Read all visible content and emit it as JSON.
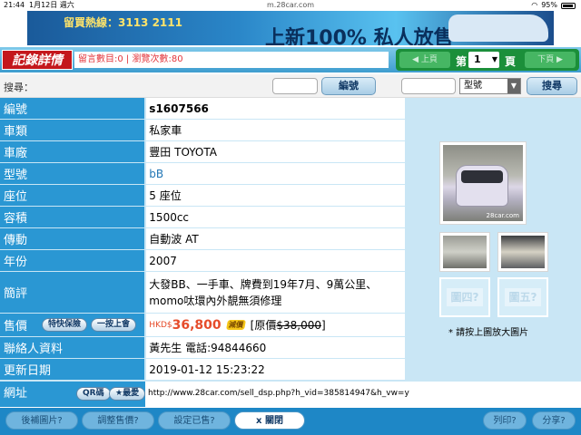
{
  "status": {
    "time": "21:44",
    "date": "1月12日 週六",
    "url": "m.28car.com",
    "battery": "95%"
  },
  "banner": {
    "left_text": "留買熱線：3113 2111",
    "big_text": "上新100% 私人放售"
  },
  "header": {
    "logo": "記錄詳情",
    "stats": "留言數目:0 | 瀏覽次數:80",
    "prev": "上頁",
    "next": "下頁",
    "di": "第",
    "page": "1",
    "ye": "頁"
  },
  "search": {
    "label": "搜尋：",
    "btn_number": "編號",
    "select_value": "型號",
    "btn_search": "搜尋"
  },
  "details": {
    "number_label": "編號",
    "number_value": "s1607566",
    "category_label": "車類",
    "category_value": "私家車",
    "make_label": "車廠",
    "make_value": "豐田 TOYOTA",
    "model_label": "型號",
    "model_value": "bB",
    "seats_label": "座位",
    "seats_value": "5 座位",
    "engine_label": "容積",
    "engine_value": "1500cc",
    "trans_label": "傳動",
    "trans_value": "自動波 AT",
    "year_label": "年份",
    "year_value": "2007",
    "remarks_label": "簡評",
    "remarks_value": "大發BB、一手車、牌費到19年7月、9萬公里、momo呔環內外靚無須修理",
    "price_label": "售價",
    "price_btn1": "特快保險",
    "price_btn2": "一按上會",
    "price_currency": "HKD$",
    "price_value": "36,800",
    "price_tag": "減價",
    "orig_prefix": "[原價 ",
    "orig_value": "$38,000",
    "orig_suffix": "]",
    "contact_label": "聯絡人資料",
    "contact_value": "黃先生 電話:94844660",
    "updated_label": "更新日期",
    "updated_value": "2019-01-12 15:23:22",
    "url_label": "網址",
    "url_btn_qr": "QR碼",
    "url_btn_fav": "★最愛",
    "url_value": "http://www.28car.com/sell_dsp.php?h_vid=385814947&h_vw=y"
  },
  "photos": {
    "watermark": "28car.com",
    "slot4": "圖四?",
    "slot5": "圖五?",
    "note": "* 請按上圖放大圖片"
  },
  "bottom": {
    "add_photo": "後補圖片?",
    "adjust_price": "調整售價?",
    "set_sold": "設定已售?",
    "close": "x 關閉",
    "print": "列印?",
    "share": "分享?"
  }
}
